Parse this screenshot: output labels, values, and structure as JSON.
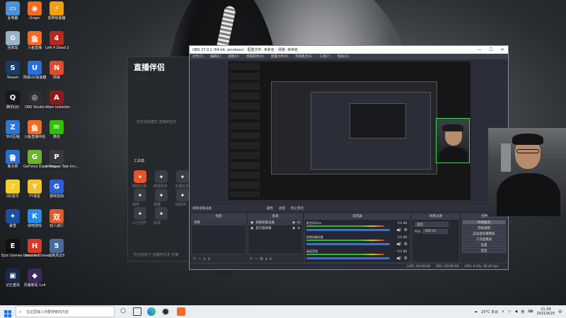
{
  "desktop": {
    "icons": [
      {
        "label": "此电脑",
        "color": "#4f90d8",
        "glyph": "▭",
        "icon": "computer-icon"
      },
      {
        "label": "Origin",
        "color": "#f26b21",
        "glyph": "◉",
        "icon": "origin-icon"
      },
      {
        "label": "雷神加速器",
        "color": "#f0a010",
        "glyph": "⚡",
        "icon": "thunder-accelerator-icon"
      },
      {
        "label": "回收站",
        "color": "#9bb3c6",
        "glyph": "♻",
        "icon": "recycle-bin-icon"
      },
      {
        "label": "斗鱼直播",
        "color": "#f36b22",
        "glyph": "鱼",
        "icon": "douyu-icon"
      },
      {
        "label": "Left 4 Dead 2",
        "color": "#b52a1c",
        "glyph": "4",
        "icon": "l4d2-icon"
      },
      {
        "label": "Steam",
        "color": "#1b3c63",
        "glyph": "S",
        "icon": "steam-icon"
      },
      {
        "label": "网易UU加速器",
        "color": "#2a6edc",
        "glyph": "U",
        "icon": "uu-accelerator-icon"
      },
      {
        "label": "网易",
        "color": "#e24a2a",
        "glyph": "N",
        "icon": "netease-icon"
      },
      {
        "label": "腾讯QQ",
        "color": "#1a1a1a",
        "glyph": "Q",
        "icon": "qq-icon"
      },
      {
        "label": "OBS Studio",
        "color": "#302e31",
        "glyph": "◎",
        "icon": "obs-icon"
      },
      {
        "label": "Alien Isolation",
        "color": "#8a1a1a",
        "glyph": "A",
        "icon": "alien-isolation-icon"
      },
      {
        "label": "360压缩",
        "color": "#2a78d8",
        "glyph": "Z",
        "icon": "zip-icon"
      },
      {
        "label": "斗鱼直播伴侣",
        "color": "#f36b22",
        "glyph": "鱼",
        "icon": "douyu-companion-icon"
      },
      {
        "label": "微信",
        "color": "#2dc100",
        "glyph": "✉",
        "icon": "wechat-icon"
      },
      {
        "label": "鲁大师",
        "color": "#2a6fd0",
        "glyph": "鲁",
        "icon": "ludashi-icon"
      },
      {
        "label": "GeForce Experience",
        "color": "#6ab42a",
        "glyph": "G",
        "icon": "geforce-icon"
      },
      {
        "label": "A Plague Tale Inn...",
        "color": "#3a3a3a",
        "glyph": "P",
        "icon": "plague-tale-icon"
      },
      {
        "label": "QQ音乐",
        "color": "#f7cf2c",
        "glyph": "♪",
        "icon": "qq-music-icon"
      },
      {
        "label": "YY语音",
        "color": "#f3c42a",
        "glyph": "Y",
        "icon": "yy-icon"
      },
      {
        "label": "游戏加加",
        "color": "#2a5fd8",
        "glyph": "G",
        "icon": "game-plus-icon"
      },
      {
        "label": "暴雪",
        "color": "#1a4fa0",
        "glyph": "✦",
        "icon": "blizzard-icon"
      },
      {
        "label": "快吧游戏",
        "color": "#2a8ce8",
        "glyph": "K",
        "icon": "kuaiba-icon"
      },
      {
        "label": "双人成行",
        "color": "#e05a2a",
        "glyph": "双",
        "icon": "it-takes-two-icon"
      },
      {
        "label": "Epic Games Launcher",
        "color": "#111111",
        "glyph": "E",
        "icon": "epic-icon"
      },
      {
        "label": "Horizon Chase...",
        "color": "#d83a2a",
        "glyph": "H",
        "icon": "horizon-chase-icon"
      },
      {
        "label": "战地风云5",
        "color": "#4a6a9a",
        "glyph": "5",
        "icon": "battlefield-icon"
      },
      {
        "label": "记忆重现",
        "color": "#1a2a4a",
        "glyph": "▣",
        "icon": "memory-icon"
      },
      {
        "label": "灵魂筹码 1v4",
        "color": "#3a2a5a",
        "glyph": "◆",
        "icon": "soul-chips-icon"
      }
    ]
  },
  "companion": {
    "title": "直播伴侣",
    "toolbox": "工具箱",
    "tip": "仅在游戏模式 直播时显示",
    "tools": [
      {
        "label": "特效礼物",
        "color": "#e8542a"
      },
      {
        "label": "房管助手",
        "color": "#3a3d44"
      },
      {
        "label": "主播任务",
        "color": "#3a3d44"
      },
      {
        "label": "抽奖",
        "color": "#3a3d44"
      },
      {
        "label": "弹幕",
        "color": "#3a3d44"
      },
      {
        "label": "全民PK",
        "color": "#3a3d44"
      },
      {
        "label": "火力全开",
        "color": "#3a3d44"
      },
      {
        "label": "投票",
        "color": "#3a3d44"
      }
    ],
    "footer": "你当前处于 直播伴侣多 开播"
  },
  "obs": {
    "title": "OBS 27.0.1 (64 bit, windows) - 配置文件: 未命名 - 场景: 未命名",
    "menu": [
      "文件(F)",
      "编辑(E)",
      "视图(V)",
      "停靠部件(D)",
      "配置文件(P)",
      "场景集合(S)",
      "工具(T)",
      "帮助(H)"
    ],
    "source_bar": {
      "name": "视频采集设备",
      "properties": "属性",
      "filters": "滤镜",
      "device": "停止激活"
    },
    "scenes_header": "场景",
    "scenes": [
      "场景"
    ],
    "sources_header": "来源",
    "sources": [
      "视频采集设备",
      "显示器采集"
    ],
    "mixer_header": "混音器",
    "mixer": [
      {
        "name": "麦克风/Aux",
        "db": "0.0 dB"
      },
      {
        "name": "视频采集设备",
        "db": "0.0 dB"
      },
      {
        "name": "桌面音频",
        "db": "-0.3 dB"
      }
    ],
    "transitions_header": "场景过渡",
    "transition": "淡出",
    "duration_label": "时长",
    "duration": "300 ms",
    "controls_header": "控件",
    "controls": [
      "开始推流",
      "开始录制",
      "启动虚拟摄像机",
      "工作室模式",
      "设置",
      "退出"
    ],
    "status": {
      "live": "LIVE: 00:00:00",
      "rec": "REC: 00:00:00",
      "cpu": "CPU: 0.4%, 30.00 fps"
    }
  },
  "taskbar": {
    "search_placeholder": "在这里输入你要搜索的内容",
    "weather": "25°C 多云",
    "lang": "英",
    "time": "21:39",
    "date": "2021/9/25"
  }
}
